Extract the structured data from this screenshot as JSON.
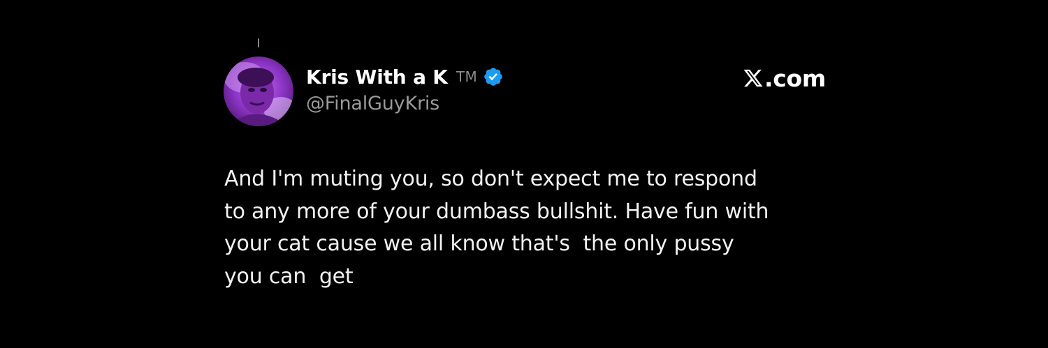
{
  "tweet": {
    "author": {
      "display_name": "Kris With a K",
      "trademark": "TM",
      "handle": "@FinalGuyKris",
      "verified": true,
      "avatar_icon": "avatar-photo",
      "verified_icon": "verified-badge-icon"
    },
    "text_lines": [
      "And I'm muting you, so don't expect me to respond",
      "to any more of your dumbass bullshit. Have fun with",
      "your cat cause we all know that's  the only pussy",
      "you can  get"
    ]
  },
  "brand": {
    "logo_icon": "x-logo-icon",
    "domain": ".com"
  },
  "colors": {
    "background": "#000000",
    "text_primary": "#ffffff",
    "text_secondary": "#9a9a9a",
    "verified_blue": "#1d9bf0",
    "avatar_tint": "#9b3fd1"
  }
}
